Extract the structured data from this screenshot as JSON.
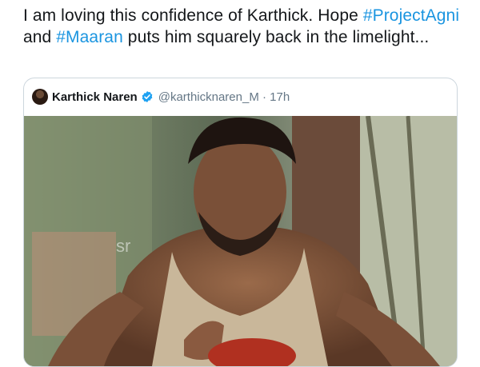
{
  "tweet": {
    "text_1": "I am loving this confidence of Karthick. Hope ",
    "hashtag_1": "#ProjectAgni",
    "text_2": " and ",
    "hashtag_2": "#Maaran",
    "text_3": " puts him squarely back in the limelight..."
  },
  "quoted_tweet": {
    "author_name": "Karthick Naren",
    "handle": "@karthicknaren_M",
    "separator": " · ",
    "time": "17h"
  },
  "media": {
    "watermark": "sr"
  },
  "colors": {
    "hashtag": "#1b95e0",
    "verified": "#1da1f2"
  }
}
